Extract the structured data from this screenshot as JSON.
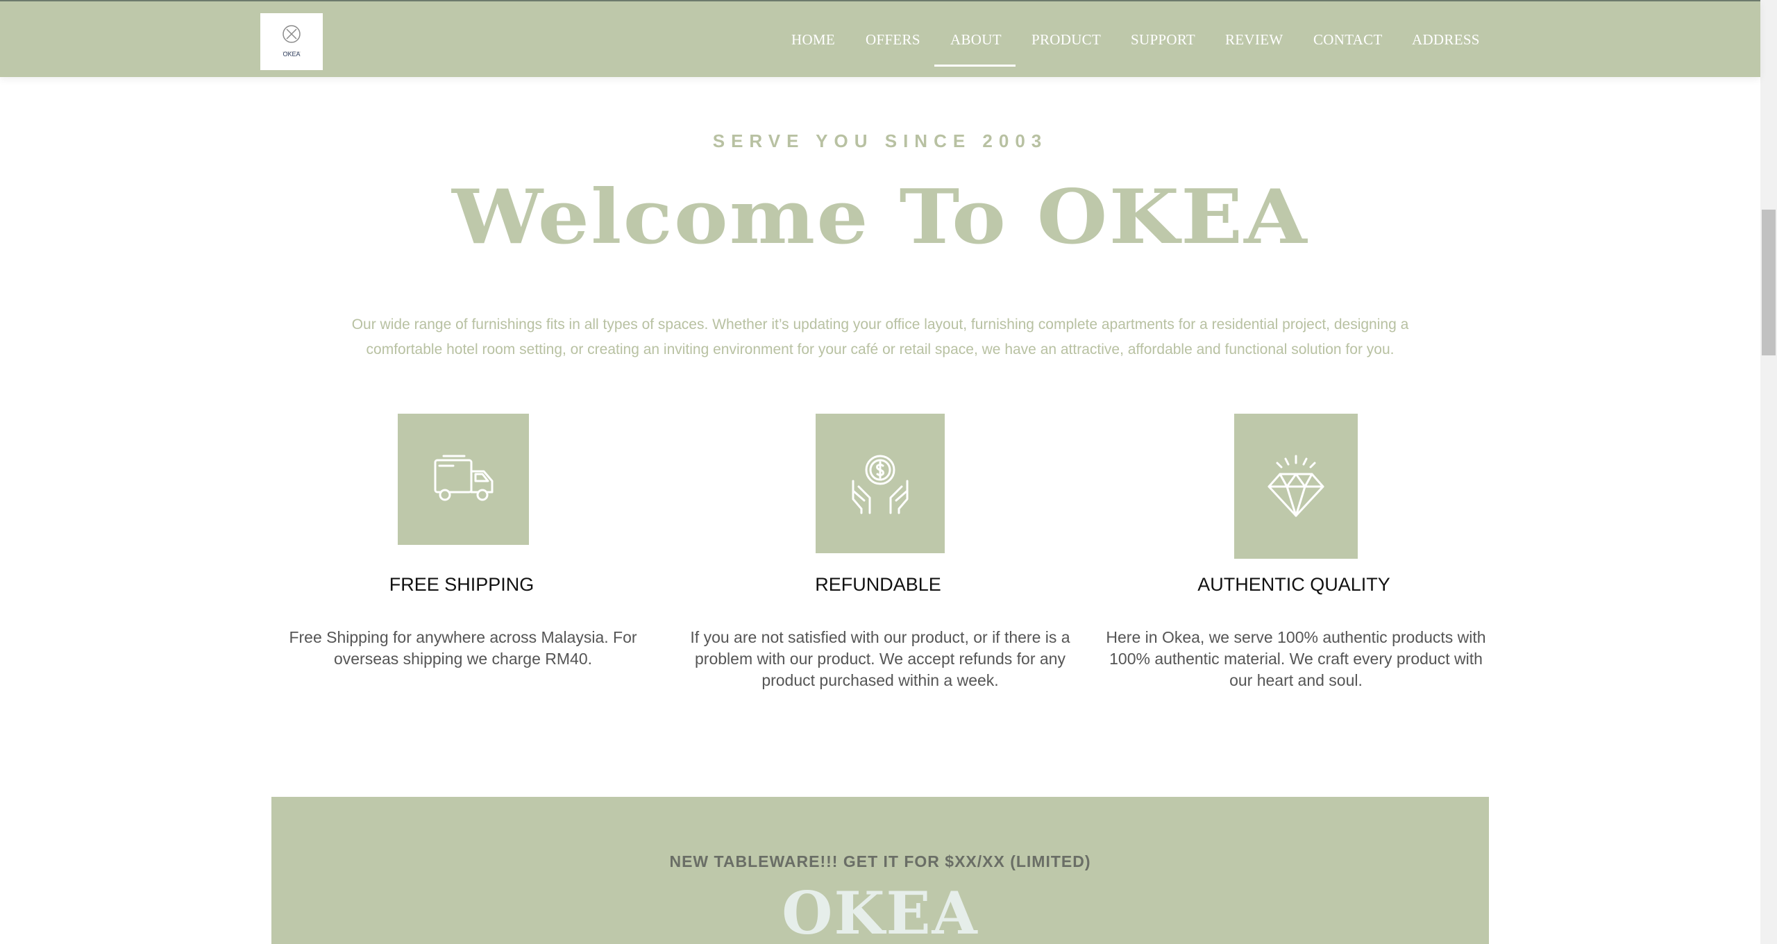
{
  "colors": {
    "primary": "#bec8aa",
    "text_muted": "#b8c1a2",
    "dark_text": "#111111",
    "body_text": "#555555"
  },
  "header": {
    "logo_text": "OKEA",
    "nav": [
      {
        "label": "HOME"
      },
      {
        "label": "OFFERS"
      },
      {
        "label": "ABOUT",
        "active": true
      },
      {
        "label": "PRODUCT"
      },
      {
        "label": "SUPPORT"
      },
      {
        "label": "REVIEW"
      },
      {
        "label": "CONTACT"
      },
      {
        "label": "ADDRESS"
      }
    ]
  },
  "about": {
    "eyebrow": "SERVE YOU SINCE 2003",
    "title": "Welcome To OKEA",
    "intro": "Our wide range of furnishings fits in all types of spaces. Whether it’s updating your office layout, furnishing complete apartments for a residential project, designing a comfortable hotel room setting, or creating an inviting environment for your café or retail space, we have an attractive, affordable and functional solution for you."
  },
  "features": [
    {
      "icon": "truck-icon",
      "title": "FREE SHIPPING",
      "text": "Free Shipping for anywhere across Malaysia. For overseas shipping we charge RM40."
    },
    {
      "icon": "money-hands-icon",
      "title": "REFUNDABLE",
      "text": "If you are not satisfied with our product, or if there is a problem with our product. We accept refunds for any product purchased within a week."
    },
    {
      "icon": "diamond-icon",
      "title": "AUTHENTIC QUALITY",
      "text": "Here in Okea, we serve 100% authentic products with 100% authentic material. We craft every product with our heart and soul."
    }
  ],
  "promo": {
    "text": "NEW TABLEWARE!!! GET IT FOR $XX/XX (LIMITED)",
    "brand": "OKEA"
  }
}
